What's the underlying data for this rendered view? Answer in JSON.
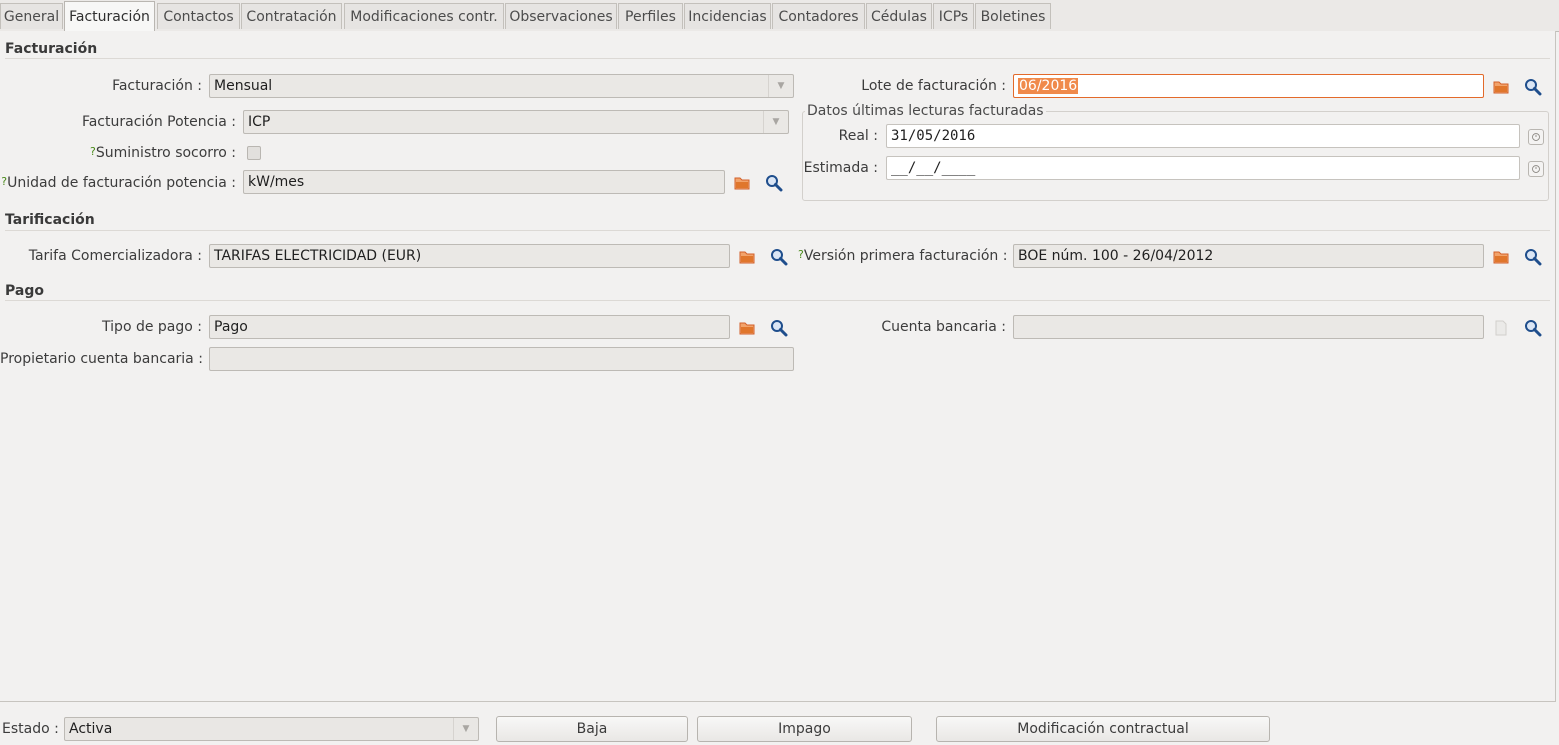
{
  "tabs": [
    "General",
    "Facturación",
    "Contactos",
    "Contratación",
    "Modificaciones contr.",
    "Observaciones",
    "Perfiles",
    "Incidencias",
    "Contadores",
    "Cédulas",
    "ICPs",
    "Boletines"
  ],
  "active_tab": "Facturación",
  "sections": {
    "facturacion": "Facturación",
    "tarificacion": "Tarificación",
    "pago": "Pago"
  },
  "facturacion": {
    "facturacion_label": "Facturación :",
    "facturacion_value": "Mensual",
    "potencia_label": "Facturación Potencia :",
    "potencia_value": "ICP",
    "suministro_label": "Suministro socorro :",
    "unidad_label": "Unidad de facturación potencia :",
    "unidad_value": "kW/mes",
    "lote_label": "Lote de facturación :",
    "lote_value": "06/2016",
    "lecturas_title": "Datos últimas lecturas facturadas",
    "real_label": "Real :",
    "real_value": "31/05/2016",
    "estimada_label": "Estimada :",
    "estimada_value": "__/__/____"
  },
  "tarificacion": {
    "tarifa_label": "Tarifa Comercializadora :",
    "tarifa_value": "TARIFAS ELECTRICIDAD (EUR)",
    "version_label": "Versión primera facturación :",
    "version_value": "BOE núm. 100 - 26/04/2012"
  },
  "pago": {
    "tipo_label": "Tipo de pago :",
    "tipo_value": "Pago",
    "cuenta_label": "Cuenta bancaria :",
    "cuenta_value": "",
    "propietario_label": "Propietario cuenta bancaria :",
    "propietario_value": ""
  },
  "help_mark": "?",
  "footer": {
    "estado_label": "Estado :",
    "estado_value": "Activa",
    "buttons": [
      "Baja",
      "Impago",
      "Modificación contractual"
    ]
  },
  "colors": {
    "accent": "#e36a2a",
    "folder": "#e0762c",
    "search": "#1f4e8c",
    "help": "#4a8a1b"
  }
}
